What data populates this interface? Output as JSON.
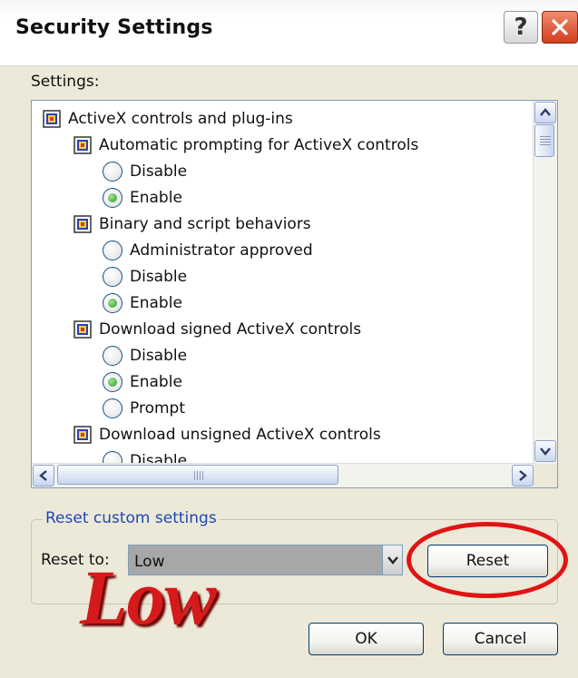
{
  "window": {
    "title": "Security Settings",
    "help_glyph": "?",
    "close_icon": "close-icon"
  },
  "settings_label": "Settings:",
  "tree": {
    "groups": [
      {
        "label": "ActiveX controls and plug-ins"
      },
      {
        "label": "Automatic prompting for ActiveX controls",
        "options": [
          "Disable",
          "Enable"
        ],
        "selected": "Enable"
      },
      {
        "label": "Binary and script behaviors",
        "options": [
          "Administrator approved",
          "Disable",
          "Enable"
        ],
        "selected": "Enable"
      },
      {
        "label": "Download signed ActiveX controls",
        "options": [
          "Disable",
          "Enable",
          "Prompt"
        ],
        "selected": "Enable"
      },
      {
        "label": "Download unsigned ActiveX controls",
        "options": [
          "Disable"
        ]
      }
    ]
  },
  "reset_group": {
    "title": "Reset custom settings",
    "reset_to_label": "Reset to:",
    "selected_level": "Low",
    "reset_button": "Reset"
  },
  "buttons": {
    "ok": "OK",
    "cancel": "Cancel"
  },
  "overlay": {
    "text": "Low",
    "color": "#d41a1a"
  },
  "colors": {
    "accent_title": "#2046b8",
    "highlight": "#e01414",
    "radio_selected": "#21a121"
  }
}
